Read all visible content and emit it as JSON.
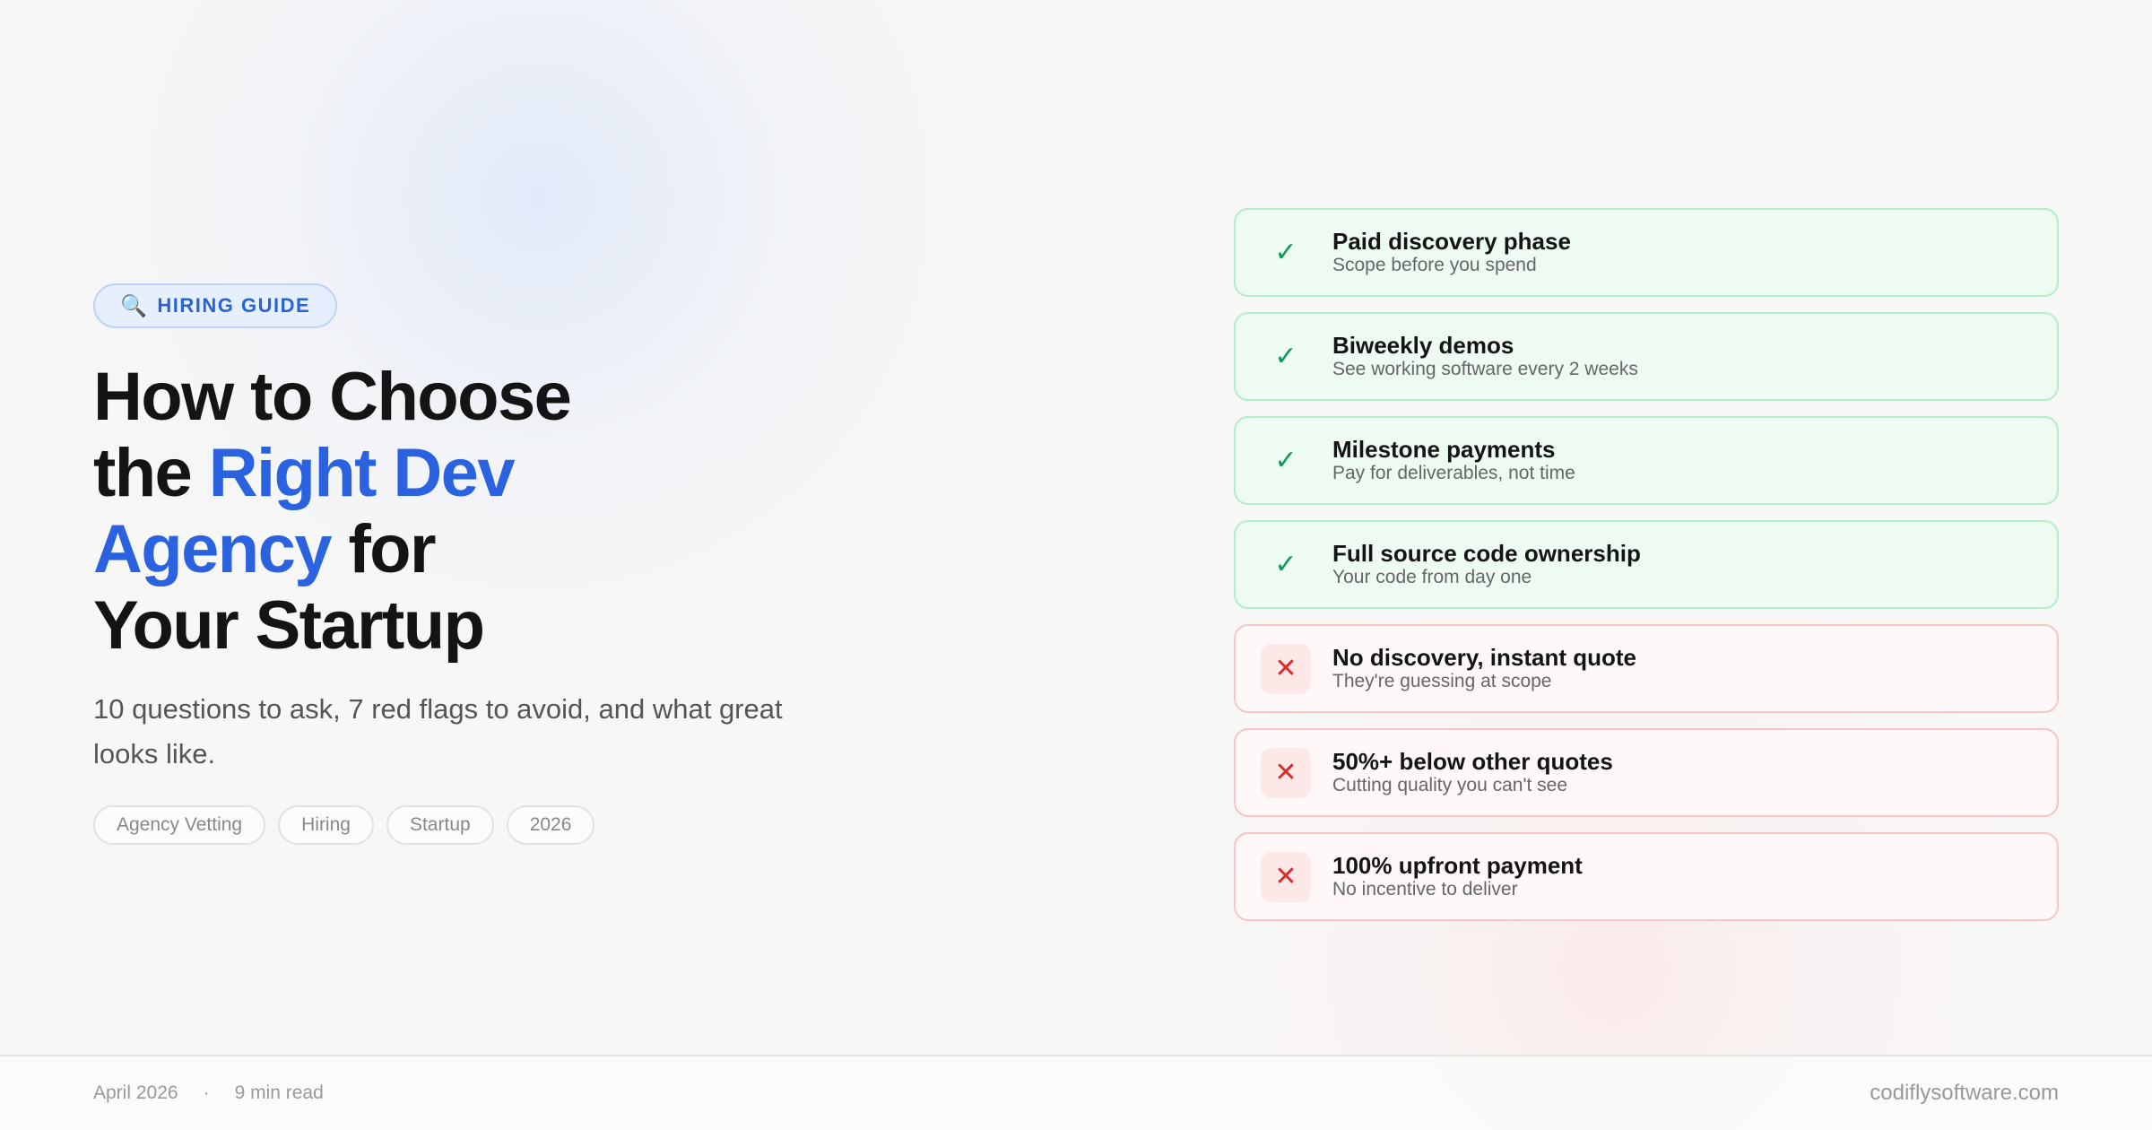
{
  "badge": {
    "icon": "🔍",
    "icon_name": "magnifier-icon",
    "label": "HIRING GUIDE"
  },
  "title": {
    "line1": "How to Choose",
    "line2_pre": "the ",
    "line2_accent": "Right Dev",
    "line3_accent": "Agency",
    "line3_post": " for",
    "line4": "Your Startup"
  },
  "subtitle": "10 questions to ask, 7 red flags to avoid, and what great looks like.",
  "tags": [
    "Agency Vetting",
    "Hiring",
    "Startup",
    "2026"
  ],
  "checklist": [
    {
      "kind": "good",
      "icon": "✓",
      "title": "Paid discovery phase",
      "subtitle": "Scope before you spend"
    },
    {
      "kind": "good",
      "icon": "✓",
      "title": "Biweekly demos",
      "subtitle": "See working software every 2 weeks"
    },
    {
      "kind": "good",
      "icon": "✓",
      "title": "Milestone payments",
      "subtitle": "Pay for deliverables, not time"
    },
    {
      "kind": "good",
      "icon": "✓",
      "title": "Full source code ownership",
      "subtitle": "Your code from day one"
    },
    {
      "kind": "bad",
      "icon": "✕",
      "title": "No discovery, instant quote",
      "subtitle": "They're guessing at scope"
    },
    {
      "kind": "bad",
      "icon": "✕",
      "title": "50%+ below other quotes",
      "subtitle": "Cutting quality you can't see"
    },
    {
      "kind": "bad",
      "icon": "✕",
      "title": "100% upfront payment",
      "subtitle": "No incentive to deliver"
    }
  ],
  "footer": {
    "date": "April 2026",
    "separator": "·",
    "read_time": "9 min read",
    "site": "codiflysoftware.com"
  },
  "colors": {
    "accent": "#2a62e0",
    "good": "#129a5a",
    "bad": "#dc2b2b"
  }
}
